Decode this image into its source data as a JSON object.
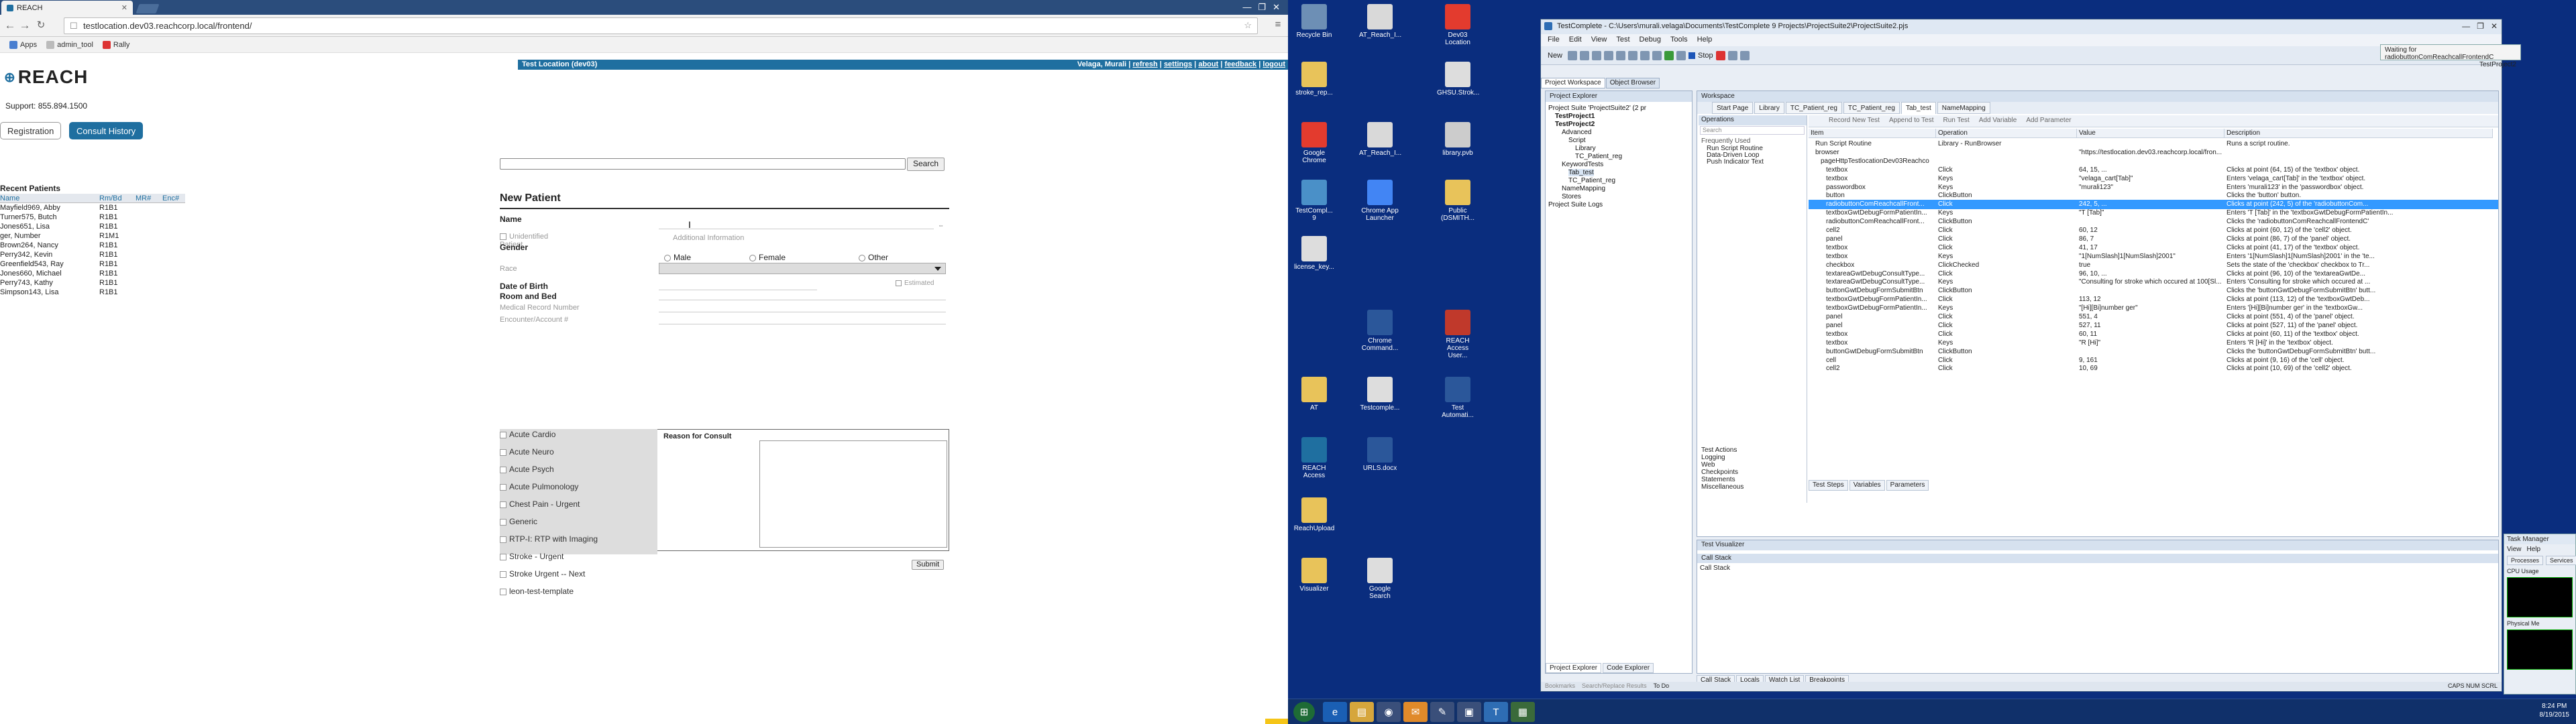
{
  "browser": {
    "tab_title": "REACH",
    "url": "testlocation.dev03.reachcorp.local/frontend/",
    "bookmarks": [
      "Apps",
      "admin_tool",
      "Rally"
    ]
  },
  "app": {
    "location": "Test Location (dev03)",
    "user_links": [
      "Velaga, Murali",
      "refresh",
      "settings",
      "about",
      "feedback",
      "logout"
    ],
    "logo": "REACH",
    "support": "Support: 855.894.1500",
    "nav": {
      "registration": "Registration",
      "consult_history": "Consult History"
    },
    "recent": {
      "title": "Recent Patients",
      "columns": [
        "Name",
        "Rm/Bd",
        "MR#",
        "Enc#"
      ],
      "rows": [
        [
          "Mayfield969, Abby",
          "R1B1"
        ],
        [
          "Turner575, Butch",
          "R1B1"
        ],
        [
          "Jones651, Lisa",
          "R1B1"
        ],
        [
          "ger, Number",
          "R1M1"
        ],
        [
          "Brown264, Nancy",
          "R1B1"
        ],
        [
          "Perry342, Kevin",
          "R1B1"
        ],
        [
          "Greenfield543, Ray",
          "R1B1"
        ],
        [
          "Jones660, Michael",
          "R1B1"
        ],
        [
          "Perry743, Kathy",
          "R1B1"
        ],
        [
          "Simpson143, Lisa",
          "R1B1"
        ]
      ]
    },
    "search_button": "Search",
    "new_patient": {
      "title": "New Patient",
      "name_label": "Name",
      "unidentified": "Unidentified Patient",
      "additional_info": "Additional Information",
      "gender_label": "Gender",
      "genders": [
        "Male",
        "Female",
        "Other"
      ],
      "race_label": "Race",
      "dob_label": "Date of Birth",
      "estimated": "Estimated",
      "room_label": "Room and Bed",
      "mrn_label": "Medical Record Number",
      "enc_label": "Encounter/Account #",
      "consult_types": [
        "Acute Cardio",
        "Acute Neuro",
        "Acute Psych",
        "Acute Pulmonology",
        "Chest Pain - Urgent",
        "Generic",
        "RTP-I: RTP with Imaging",
        "Stroke - Urgent",
        "Stroke Urgent -- Next",
        "leon-test-template"
      ],
      "reason_label": "Reason for Consult",
      "submit": "Submit"
    }
  },
  "desktop": {
    "icons": [
      {
        "label": "Recycle Bin",
        "color": "#6d8fb5"
      },
      {
        "label": "AT_Reach_I...",
        "color": "#d9d9d9"
      },
      {
        "label": "Dev03 Location",
        "color": "#e33b2e"
      },
      {
        "label": "stroke_rep...",
        "color": "#e8c35a"
      },
      {
        "label": "GHSU.Strok...",
        "color": "#dddddd"
      },
      {
        "label": "Google Chrome",
        "color": "#e33b2e"
      },
      {
        "label": "AT_Reach_I...",
        "color": "#d9d9d9"
      },
      {
        "label": "library.pvb",
        "color": "#cccccc"
      },
      {
        "label": "TestCompl... 9",
        "color": "#4a90c8"
      },
      {
        "label": "Chrome App Launcher",
        "color": "#4285f4"
      },
      {
        "label": "Public (DSMITH...",
        "color": "#e8c35a"
      },
      {
        "label": "license_key...",
        "color": "#dddddd"
      },
      {
        "label": "Chrome Command...",
        "color": "#2b579a"
      },
      {
        "label": "REACH Access User...",
        "color": "#c0392b"
      },
      {
        "label": "AT",
        "color": "#e8c35a"
      },
      {
        "label": "Testcomple...",
        "color": "#dddddd"
      },
      {
        "label": "Test Automati...",
        "color": "#2b579a"
      },
      {
        "label": "REACH Access",
        "color": "#1f6fa0"
      },
      {
        "label": "URLS.docx",
        "color": "#2b579a"
      },
      {
        "label": "ReachUpload",
        "color": "#e8c35a"
      },
      {
        "label": "Visualizer",
        "color": "#e8c35a"
      },
      {
        "label": "Google Search",
        "color": "#dddddd"
      }
    ]
  },
  "tc": {
    "title": "TestComplete - C:\\Users\\murali.velaga\\Documents\\TestComplete 9 Projects\\ProjectSuite2\\ProjectSuite2.pjs",
    "menu": [
      "File",
      "Edit",
      "View",
      "Test",
      "Debug",
      "Tools",
      "Help"
    ],
    "new_label": "New",
    "stop_label": "Stop",
    "pw_tabs": [
      "Project Workspace",
      "Object Browser"
    ],
    "pe_title": "Project Explorer",
    "search": "Search",
    "tree": [
      "Project Suite 'ProjectSuite2' (2 pr",
      "TestProject1",
      "TestProject2",
      "Advanced",
      "Script",
      "Library",
      "TC_Patient_reg",
      "KeywordTests",
      "Tab_test",
      "TC_Patient_reg",
      "NameMapping",
      "Stores",
      "Project Suite Logs"
    ],
    "ws_title": "Workspace",
    "ws_tabs": [
      "Start Page",
      "Library",
      "TC_Patient_reg",
      "TC_Patient_reg",
      "Tab_test",
      "NameMapping"
    ],
    "ops_title": "Operations",
    "ops_freq": "Frequently Used",
    "ops": [
      "Run Script Routine",
      "Data-Driven Loop",
      "Push Indicator Text"
    ],
    "ops_cats": [
      "Test Actions",
      "Logging",
      "Web",
      "Checkpoints",
      "Statements",
      "Miscellaneous"
    ],
    "kt_tools": [
      "Record New Test",
      "Append to Test",
      "Run Test",
      "Add Variable",
      "Add Parameter"
    ],
    "grid_cols": [
      "Item",
      "Operation",
      "Value",
      "Description"
    ],
    "rows": [
      [
        "Run Script Routine",
        "Library - RunBrowser",
        "",
        "Runs a script routine."
      ],
      [
        "browser",
        "",
        "\"https://testlocation.dev03.reachcorp.local/fron...",
        ""
      ],
      [
        "pageHttpTestlocationDev03Reachco",
        "",
        "",
        ""
      ],
      [
        "textbox",
        "Click",
        "64, 15, ...",
        "Clicks at point (64, 15) of the 'textbox' object."
      ],
      [
        "textbox",
        "Keys",
        "\"velaga_cart[Tab]\"",
        "Enters 'velaga_cart[Tab]' in the 'textbox' object."
      ],
      [
        "passwordbox",
        "Keys",
        "\"murali123\"",
        "Enters 'murali123' in the 'passwordbox' object."
      ],
      [
        "button",
        "ClickButton",
        "",
        "Clicks the 'button' button."
      ],
      [
        "radiobuttonComReachcallFront...",
        "Click",
        "242, 5, ...",
        "Clicks at point (242, 5) of the 'radiobuttonCom..."
      ],
      [
        "textboxGwtDebugFormPatientIn...",
        "Keys",
        "\"T [Tab]\"",
        "Enters 'T [Tab]' in the 'textboxGwtDebugFormPatientIn..."
      ],
      [
        "radiobuttonComReachcallFront...",
        "ClickButton",
        "",
        "Clicks the 'radiobuttonComReachcallFrontendC'"
      ],
      [
        "cell2",
        "Click",
        "60, 12",
        "Clicks at point (60, 12) of the 'cell2' object."
      ],
      [
        "panel",
        "Click",
        "86, 7",
        "Clicks at point (86, 7) of the 'panel' object."
      ],
      [
        "textbox",
        "Click",
        "41, 17",
        "Clicks at point (41, 17) of the 'textbox' object."
      ],
      [
        "textbox",
        "Keys",
        "\"1[NumSlash]1[NumSlash]2001\"",
        "Enters '1[NumSlash]1[NumSlash]2001' in the 'te..."
      ],
      [
        "checkbox",
        "ClickChecked",
        "true",
        "Sets the state of the 'checkbox' checkbox to Tr..."
      ],
      [
        "textareaGwtDebugConsultType...",
        "Click",
        "96, 10, ...",
        "Clicks at point (96, 10) of the 'textareaGwtDe..."
      ],
      [
        "textareaGwtDebugConsultType...",
        "Keys",
        "\"Consulting for stroke which occured at 100[Sl...",
        "Enters 'Consulting for stroke which occured at ..."
      ],
      [
        "buttonGwtDebugFormSubmitBtn",
        "ClickButton",
        "",
        "Clicks the 'buttonGwtDebugFormSubmitBtn' butt..."
      ],
      [
        "textboxGwtDebugFormPatientIn...",
        "Click",
        "113, 12",
        "Clicks at point (113, 12) of the 'textboxGwtDeb..."
      ],
      [
        "textboxGwtDebugFormPatientIn...",
        "Keys",
        "\"[Hi][Bi]number ger\"",
        "Enters '[Hi][Bi]number ger' in the 'textboxGw..."
      ],
      [
        "panel",
        "Click",
        "551, 4",
        "Clicks at point (551, 4) of the 'panel' object."
      ],
      [
        "panel",
        "Click",
        "527, 11",
        "Clicks at point (527, 11) of the 'panel' object."
      ],
      [
        "textbox",
        "Click",
        "60, 11",
        "Clicks at point (60, 11) of the 'textbox' object."
      ],
      [
        "textbox",
        "Keys",
        "\"R [Hi]\"",
        "Enters 'R [Hi]' in the 'textbox' object."
      ],
      [
        "buttonGwtDebugFormSubmitBtn",
        "ClickButton",
        "",
        "Clicks the 'buttonGwtDebugFormSubmitBtn' butt..."
      ],
      [
        "cell",
        "Click",
        "9, 161",
        "Clicks at point (9, 16) of the 'cell' object."
      ],
      [
        "cell2",
        "Click",
        "10, 69",
        "Clicks at point (10, 69) of the 'cell2' object."
      ]
    ],
    "bottom_tabs": [
      "Test Steps",
      "Variables",
      "Parameters"
    ],
    "test_visualizer": "Test Visualizer",
    "call_stack": "Call Stack",
    "call_stack_col": "Call Stack",
    "btabs": [
      "Call Stack",
      "Locals",
      "Watch List",
      "Breakpoints"
    ],
    "pe_btabs": [
      "Project Explorer",
      "Code Explorer"
    ],
    "status_tabs": [
      "Bookmarks",
      "Search/Replace Results",
      "To Do"
    ],
    "status_flags": "CAPS  NUM  SCRL"
  },
  "toast": {
    "line1": "Waiting for radiobuttonComReachcallFrontendC",
    "line2": "TestProject2"
  },
  "taskmgr": {
    "title": "Task Manager",
    "menu": [
      "View",
      "Help"
    ],
    "tabs": [
      "Processes",
      "Services"
    ],
    "cpu": "CPU Usage",
    "phys": "Physical Me"
  },
  "tray": {
    "time": "8:24 PM",
    "date": "8/19/2015"
  }
}
